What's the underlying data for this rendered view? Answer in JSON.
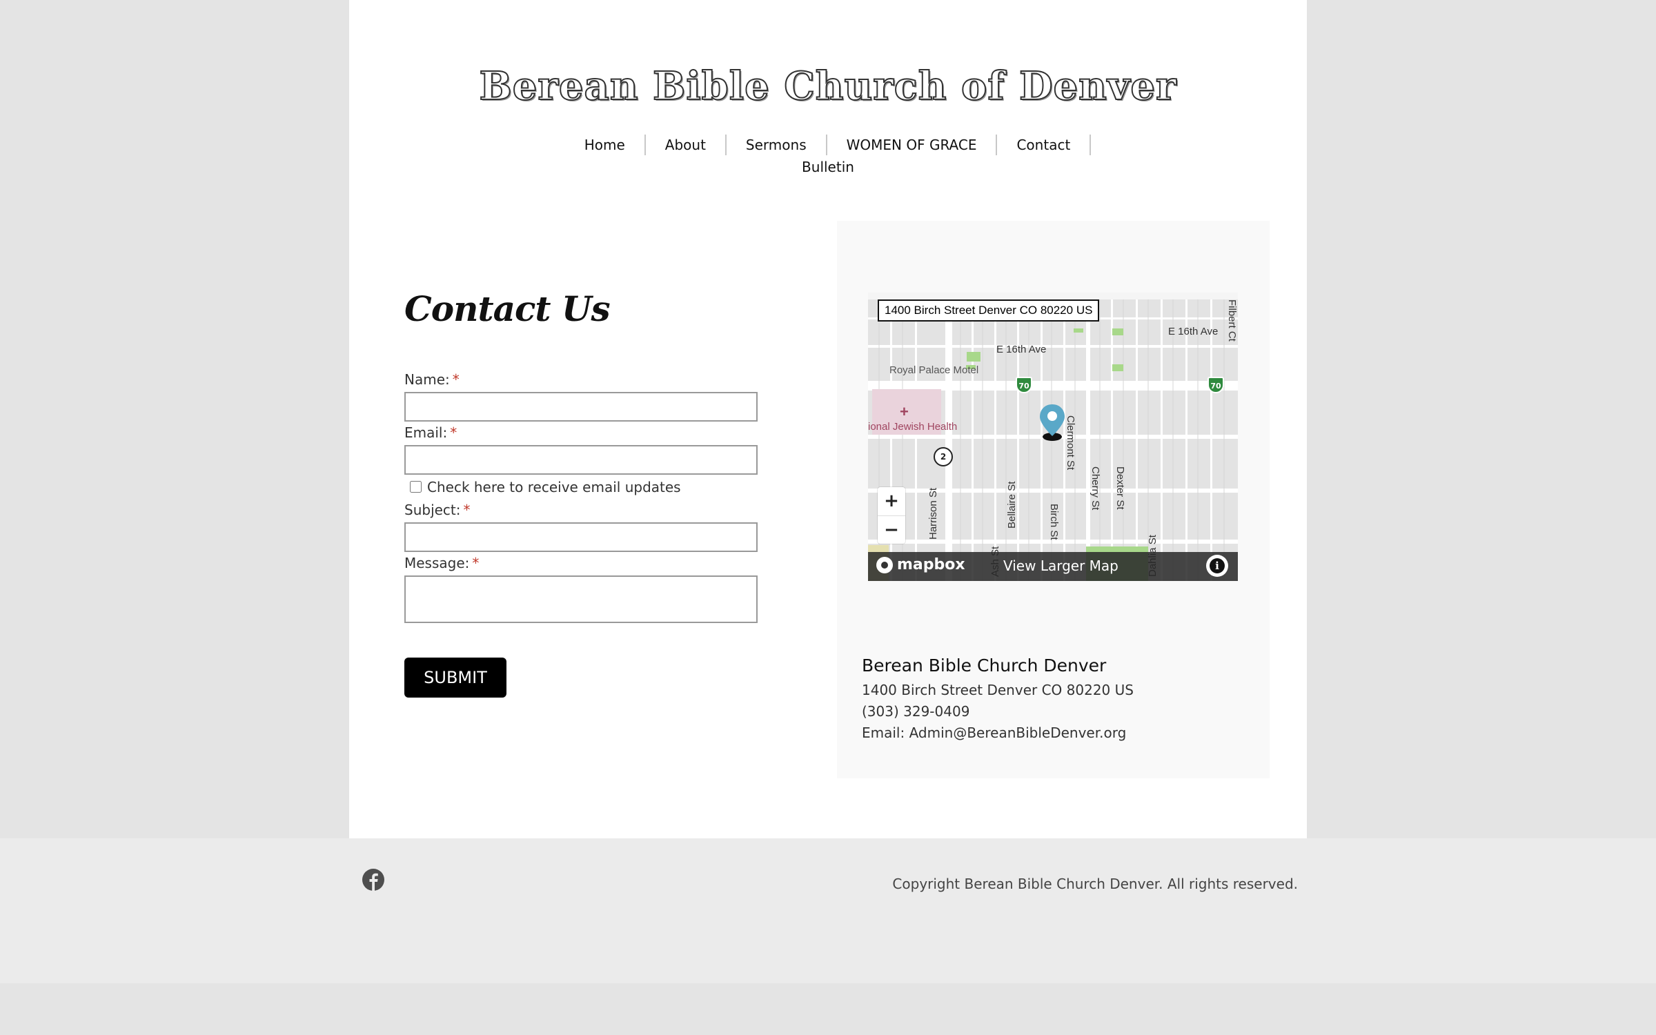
{
  "site": {
    "title": "Berean Bible Church of Denver"
  },
  "nav": {
    "items": [
      {
        "label": "Home"
      },
      {
        "label": "About"
      },
      {
        "label": "Sermons"
      },
      {
        "label": "WOMEN OF GRACE"
      },
      {
        "label": "Contact"
      }
    ],
    "second_row": [
      {
        "label": "Bulletin"
      }
    ]
  },
  "contact": {
    "heading": "Contact Us",
    "required_marker": "*",
    "fields": {
      "name": {
        "label": "Name:",
        "value": ""
      },
      "email": {
        "label": "Email:",
        "value": ""
      },
      "subject": {
        "label": "Subject:",
        "value": ""
      },
      "message": {
        "label": "Message:",
        "value": ""
      }
    },
    "checkbox": {
      "label": "Check here to receive email updates",
      "checked": false
    },
    "submit_label": "SUBMIT"
  },
  "map": {
    "address_label": "1400 Birch Street Denver CO 80220 US",
    "streets": {
      "e16th_left": "E 16th Ave",
      "e16th_right": "E 16th Ave",
      "filbert": "Filbert Ct",
      "harrison": "Harrison St",
      "bellaire": "Bellaire St",
      "birch": "Birch St",
      "clermont": "Clermont St",
      "cherry": "Cherry St",
      "dexter": "Dexter St",
      "dahlia": "Dahlia St",
      "ash": "Ash St"
    },
    "pois": {
      "motel": "Royal Palace Motel",
      "hospital": "ional Jewish Health"
    },
    "route_shield": "70",
    "route_circle": "2",
    "zoom_in": "+",
    "zoom_out": "−",
    "attribution_logo": "mapbox",
    "view_larger": "View Larger Map",
    "info_glyph": "i",
    "pin_color": "#5aa8c8"
  },
  "org": {
    "name": "Berean Bible Church Denver",
    "address": "1400 Birch Street Denver CO 80220 US",
    "phone": "(303) 329-0409",
    "email": "Email: Admin@BereanBibleDenver.org"
  },
  "footer": {
    "copyright": "Copyright Berean Bible Church Denver. All rights reserved.",
    "social": [
      {
        "icon": "facebook-icon"
      }
    ]
  }
}
